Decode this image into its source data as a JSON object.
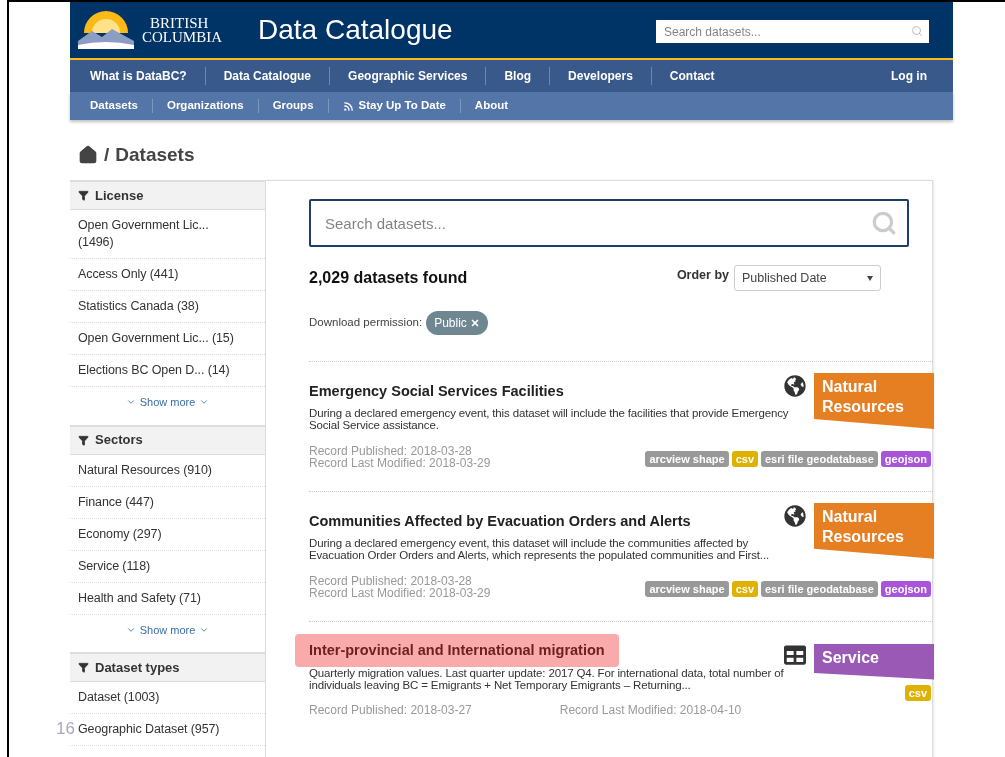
{
  "header": {
    "logo_lines": [
      "BRITISH",
      "COLUMBIA"
    ],
    "title": "Data Catalogue",
    "search_placeholder": "Search datasets..."
  },
  "nav": {
    "items": [
      {
        "label": "What is DataBC?"
      },
      {
        "label": "Data Catalogue"
      },
      {
        "label": "Geographic Services"
      },
      {
        "label": "Blog"
      },
      {
        "label": "Developers"
      },
      {
        "label": "Contact"
      }
    ],
    "login": "Log in"
  },
  "subnav": [
    {
      "label": "Datasets",
      "kind": "plain"
    },
    {
      "label": "Organizations",
      "kind": "plain"
    },
    {
      "label": "Groups",
      "kind": "plain"
    },
    {
      "label": "Stay Up To Date",
      "kind": "feed"
    },
    {
      "label": "About",
      "kind": "plain"
    }
  ],
  "breadcrumb_separator": "/",
  "breadcrumb": "Datasets",
  "facets": [
    {
      "title": "License",
      "items": [
        "Open Government Lic... (1496)",
        "Access Only (441)",
        "Statistics Canada (38)",
        "Open Government Lic... (15)",
        "Elections BC Open D... (14)"
      ],
      "show_more": "Show more"
    },
    {
      "title": "Sectors",
      "items": [
        "Natural Resources (910)",
        "Finance (447)",
        "Economy (297)",
        "Service (118)",
        "Health and Safety (71)"
      ],
      "show_more": "Show more"
    },
    {
      "title": "Dataset types",
      "items": [
        "Dataset (1003)",
        "Geographic Dataset (957)"
      ]
    }
  ],
  "results": {
    "search_placeholder": "Search datasets...",
    "count": "2,029 datasets found",
    "order_label": "Order by",
    "order_value": "Published Date",
    "filter_label": "Download permission:",
    "filter_chip": "Public"
  },
  "datasets": [
    {
      "title": "Emergency Social Services Facilities",
      "highlighted": false,
      "description": "During a declared emergency event, this dataset will include the facilities that provide Emergency Social Service assistance.",
      "kind": "geographic",
      "sector": "Natural Resources",
      "color": "#e67e22",
      "formats": [
        {
          "label": "arcview shape",
          "color": "#999999"
        },
        {
          "label": "csv",
          "color": "#dfb100"
        },
        {
          "label": "esri file geodatabase",
          "color": "#999999"
        },
        {
          "label": "geojson",
          "color": "#a855d9"
        }
      ],
      "published": "Record Published: 2018-03-28",
      "modified": "Record Last Modified: 2018-03-29",
      "dates_inline": false
    },
    {
      "title": "Communities Affected by Evacuation Orders and Alerts",
      "highlighted": false,
      "description": "During a declared emergency event, this dataset will include the communities affected by Evacuation Order Orders and Alerts, which represents the populated communities and First...",
      "kind": "geographic",
      "sector": "Natural Resources",
      "color": "#e67e22",
      "formats": [
        {
          "label": "arcview shape",
          "color": "#999999"
        },
        {
          "label": "csv",
          "color": "#dfb100"
        },
        {
          "label": "esri file geodatabase",
          "color": "#999999"
        },
        {
          "label": "geojson",
          "color": "#a855d9"
        }
      ],
      "published": "Record Published: 2018-03-28",
      "modified": "Record Last Modified: 2018-03-29",
      "dates_inline": false
    },
    {
      "title": "Inter-provincial and International migration",
      "highlighted": true,
      "description": "Quarterly migration values. Last quarter update: 2017 Q4. For international data, total number of individuals leaving BC = Emigrants + Net Temporary Emigrants – Returning...",
      "kind": "tabular",
      "sector": "Service",
      "color": "#9b59b6",
      "formats": [
        {
          "label": "csv",
          "color": "#dfb100"
        }
      ],
      "published": "Record Published: 2018-03-27",
      "modified": "Record Last Modified: 2018-04-10",
      "dates_inline": true
    }
  ],
  "slide_number": "16"
}
